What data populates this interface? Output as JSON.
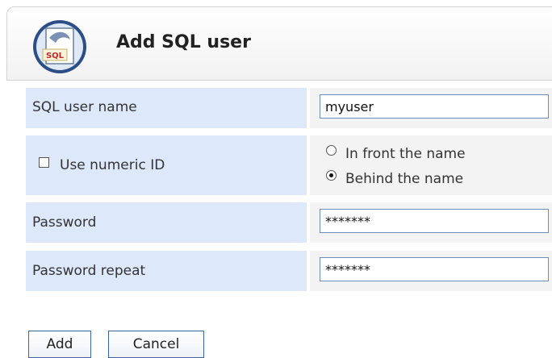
{
  "header": {
    "title": "Add SQL user",
    "logo_icon": "sql-database-icon",
    "logo_text": "SQL"
  },
  "form": {
    "username": {
      "label": "SQL user name",
      "value": "myuser"
    },
    "numeric_id": {
      "label": "Use numeric ID",
      "checked": false,
      "options": [
        {
          "label": "In front the name",
          "selected": false
        },
        {
          "label": "Behind the name",
          "selected": true
        }
      ]
    },
    "password": {
      "label": "Password",
      "value": "*******"
    },
    "password_repeat": {
      "label": "Password repeat",
      "value": "*******"
    }
  },
  "buttons": {
    "add": "Add",
    "cancel": "Cancel"
  },
  "colors": {
    "label_bg": "#dde9fb",
    "value_bg": "#f3f3f3",
    "input_border": "#6a8fbf",
    "button_border": "#3a64a8"
  }
}
